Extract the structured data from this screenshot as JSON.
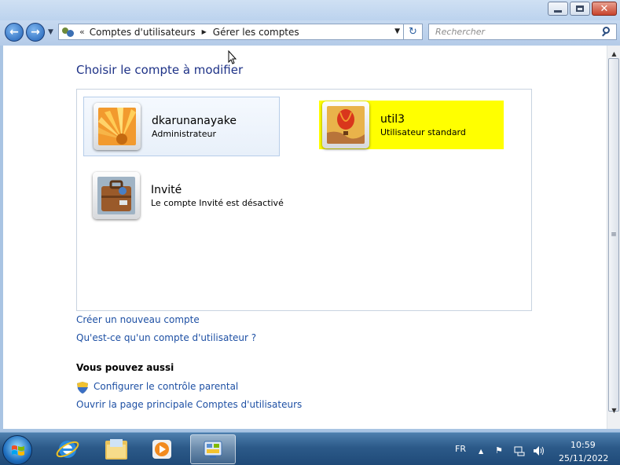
{
  "window": {
    "controls": {
      "minimize": "minimize",
      "maximize": "maximize",
      "close": "close"
    }
  },
  "navigation": {
    "back_icon": "back-arrow-icon",
    "forward_icon": "forward-arrow-icon",
    "breadcrumb_overflow": "«",
    "breadcrumbs": [
      "Comptes d'utilisateurs",
      "Gérer les comptes"
    ],
    "search_placeholder": "Rechercher"
  },
  "main": {
    "title": "Choisir le compte à modifier",
    "accounts": [
      {
        "name": "dkarunanayake",
        "role": "Administrateur",
        "avatar": "flower-avatar"
      },
      {
        "name": "util3",
        "role": "Utilisateur standard",
        "avatar": "balloon-avatar",
        "highlight_color": "#ffff00"
      },
      {
        "name": "Invité",
        "role": "Le compte Invité est désactivé",
        "avatar": "suitcase-avatar"
      }
    ],
    "links": {
      "create_account": "Créer un nouveau compte",
      "what_is_account": "Qu'est-ce qu'un compte d'utilisateur ?"
    },
    "also": {
      "heading": "Vous pouvez aussi",
      "parental_control": "Configurer le contrôle parental",
      "main_page": "Ouvrir la page principale Comptes d'utilisateurs"
    }
  },
  "taskbar": {
    "apps": [
      "internet-explorer-icon",
      "file-explorer-icon",
      "media-player-icon",
      "control-panel-icon"
    ],
    "language": "FR",
    "time": "10:59",
    "date": "25/11/2022"
  },
  "colors": {
    "link": "#1e50a4",
    "title": "#1e3287",
    "highlight": "#ffff00"
  }
}
